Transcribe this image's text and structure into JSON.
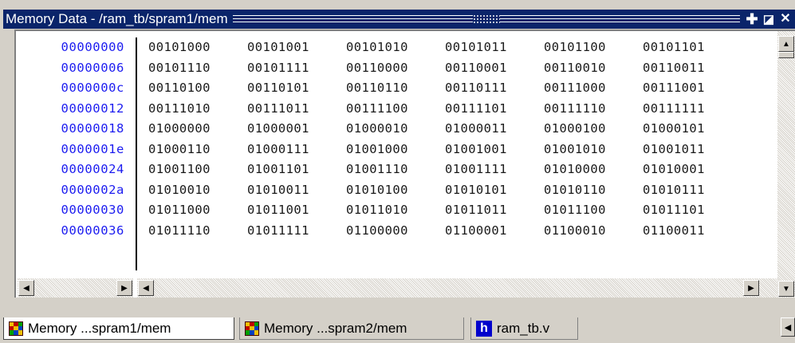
{
  "window": {
    "title": "Memory Data - /ram_tb/spram1/mem",
    "buttons": {
      "dock": "✚",
      "undock": "◪",
      "close": "✕"
    }
  },
  "memory": {
    "addresses": [
      "00000000",
      "00000006",
      "0000000c",
      "00000012",
      "00000018",
      "0000001e",
      "00000024",
      "0000002a",
      "00000030",
      "00000036"
    ],
    "rows": [
      [
        "00101000",
        "00101001",
        "00101010",
        "00101011",
        "00101100",
        "00101101"
      ],
      [
        "00101110",
        "00101111",
        "00110000",
        "00110001",
        "00110010",
        "00110011"
      ],
      [
        "00110100",
        "00110101",
        "00110110",
        "00110111",
        "00111000",
        "00111001"
      ],
      [
        "00111010",
        "00111011",
        "00111100",
        "00111101",
        "00111110",
        "00111111"
      ],
      [
        "01000000",
        "01000001",
        "01000010",
        "01000011",
        "01000100",
        "01000101"
      ],
      [
        "01000110",
        "01000111",
        "01001000",
        "01001001",
        "01001010",
        "01001011"
      ],
      [
        "01001100",
        "01001101",
        "01001110",
        "01001111",
        "01010000",
        "01010001"
      ],
      [
        "01010010",
        "01010011",
        "01010100",
        "01010101",
        "01010110",
        "01010111"
      ],
      [
        "01011000",
        "01011001",
        "01011010",
        "01011011",
        "01011100",
        "01011101"
      ],
      [
        "01011110",
        "01011111",
        "01100000",
        "01100001",
        "01100010",
        "01100011"
      ]
    ]
  },
  "scroll": {
    "up": "▲",
    "down": "▼",
    "left": "◀",
    "right": "▶"
  },
  "tabs": [
    {
      "label": "Memory ...spram1/mem",
      "icon": "memory-icon",
      "active": true
    },
    {
      "label": "Memory ...spram2/mem",
      "icon": "memory-icon",
      "active": false
    },
    {
      "label": "ram_tb.v",
      "icon": "verilog-file-icon",
      "active": false
    }
  ],
  "icon_glyphs": {
    "verilog": "h"
  },
  "colors": {
    "title_bg": "#0a246a",
    "address_text": "#1c1cf0",
    "verilog_icon": "#0000cc"
  }
}
